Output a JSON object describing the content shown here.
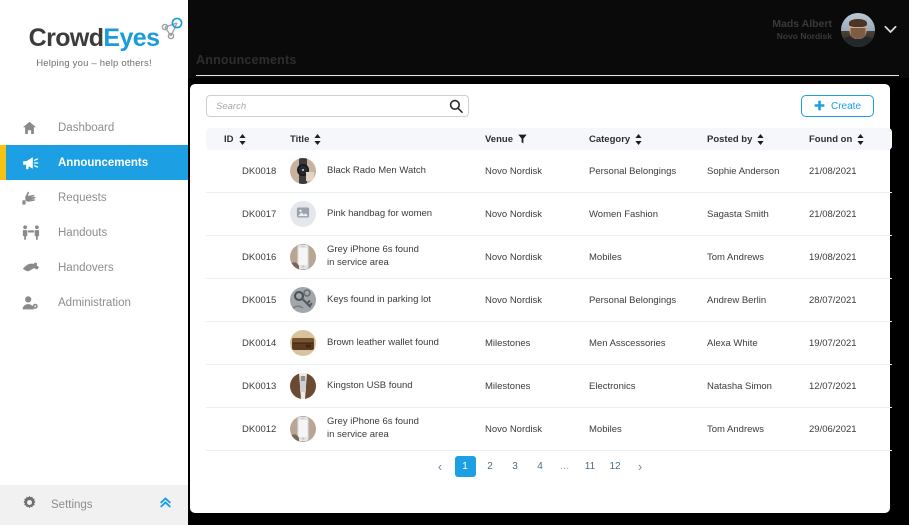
{
  "brand": {
    "word_first": "Crowd",
    "word_second": "Eyes",
    "tagline": "Helping you – help others!",
    "color_primary": "#1CA0E3",
    "color_accent": "#F6C315"
  },
  "sidebar": {
    "items": [
      {
        "label": "Dashboard",
        "icon": "home-icon",
        "active": false
      },
      {
        "label": "Announcements",
        "icon": "megaphone-icon",
        "active": true
      },
      {
        "label": "Requests",
        "icon": "raised-hand-icon",
        "active": false
      },
      {
        "label": "Handouts",
        "icon": "handout-people-icon",
        "active": false
      },
      {
        "label": "Handovers",
        "icon": "handshake-icon",
        "active": false
      },
      {
        "label": "Administration",
        "icon": "user-admin-icon",
        "active": false
      }
    ],
    "settings": {
      "label": "Settings",
      "icon": "gear-icon",
      "collapse_icon": "double-chevron-up-icon"
    }
  },
  "header": {
    "page_title": "Announcements",
    "user": {
      "name": "Mads Albert",
      "organization": "Novo Nordisk",
      "avatar": "user-photo",
      "menu_icon": "chevron-down-icon"
    }
  },
  "toolbar": {
    "search": {
      "placeholder": "Search",
      "value": "",
      "icon": "search-icon"
    },
    "create": {
      "label": "Create",
      "icon": "plus-icon"
    }
  },
  "table": {
    "columns": [
      {
        "label": "ID",
        "control": "sort-icon"
      },
      {
        "label": "Title",
        "control": "sort-icon"
      },
      {
        "label": "Venue",
        "control": "filter-icon"
      },
      {
        "label": "Category",
        "control": "sort-icon"
      },
      {
        "label": "Posted by",
        "control": "sort-icon"
      },
      {
        "label": "Found on",
        "control": "sort-icon"
      }
    ],
    "rows": [
      {
        "id": "DK0018",
        "thumb": "watch-photo",
        "title_line1": "Black Rado Men Watch",
        "title_line2": "",
        "venue": "Novo Nordisk",
        "category": "Personal Belongings",
        "posted_by": "Sophie Anderson",
        "found_on": "21/08/2021"
      },
      {
        "id": "DK0017",
        "thumb": "image-placeholder",
        "title_line1": "Pink handbag for women",
        "title_line2": "",
        "venue": "Novo Nordisk",
        "category": "Women Fashion",
        "posted_by": "Sagasta Smith",
        "found_on": "21/08/2021"
      },
      {
        "id": "DK0016",
        "thumb": "iphone-photo",
        "title_line1": "Grey iPhone 6s found",
        "title_line2": "in service area",
        "venue": "Novo Nordisk",
        "category": "Mobiles",
        "posted_by": "Tom Andrews",
        "found_on": "19/08/2021"
      },
      {
        "id": "DK0015",
        "thumb": "keys-photo",
        "title_line1": "Keys found in parking lot",
        "title_line2": "",
        "venue": "Novo Nordisk",
        "category": "Personal Belongings",
        "posted_by": "Andrew Berlin",
        "found_on": "28/07/2021"
      },
      {
        "id": "DK0014",
        "thumb": "wallet-photo",
        "title_line1": "Brown leather wallet found",
        "title_line2": "",
        "venue": "Milestones",
        "category": "Men Asscessories",
        "posted_by": "Alexa White",
        "found_on": "19/07/2021"
      },
      {
        "id": "DK0013",
        "thumb": "usb-photo",
        "title_line1": "Kingston USB found",
        "title_line2": "",
        "venue": "Milestones",
        "category": "Electronics",
        "posted_by": "Natasha Simon",
        "found_on": "12/07/2021"
      },
      {
        "id": "DK0012",
        "thumb": "iphone-photo",
        "title_line1": "Grey iPhone 6s found",
        "title_line2": "in service area",
        "venue": "Novo Nordisk",
        "category": "Mobiles",
        "posted_by": "Tom Andrews",
        "found_on": "29/06/2021"
      }
    ]
  },
  "pagination": {
    "prev": "‹",
    "next": "›",
    "pages": [
      "1",
      "2",
      "3",
      "4",
      "…",
      "11",
      "12"
    ],
    "current": "1"
  }
}
